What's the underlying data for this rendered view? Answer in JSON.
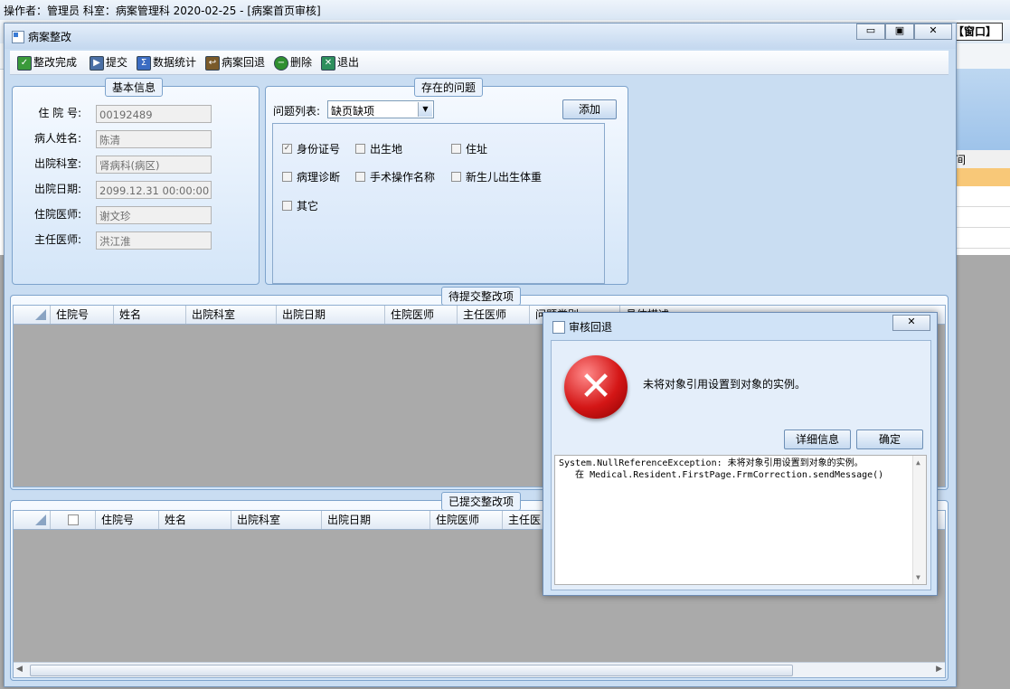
{
  "app": {
    "title_bar": "操作者：管理员  科室：病案管理科  2020-02-25 - [病案首页审核]",
    "window_menu": "【窗口】",
    "grid_col_fragment": "间"
  },
  "form": {
    "title": "病案整改",
    "toolbar": [
      {
        "label": "整改完成",
        "icon": "check-icon",
        "color": "#3a9a3a"
      },
      {
        "label": "提交",
        "icon": "submit-icon",
        "color": "#4a6fa5"
      },
      {
        "label": "数据统计",
        "icon": "sigma-icon",
        "color": "#3b6cc2"
      },
      {
        "label": "病案回退",
        "icon": "return-icon",
        "color": "#7a5a2a"
      },
      {
        "label": "删除",
        "icon": "delete-icon",
        "color": "#2f8f2f"
      },
      {
        "label": "退出",
        "icon": "exit-icon",
        "color": "#2d8f5d"
      }
    ],
    "basic_info": {
      "title": "基本信息",
      "fields": [
        {
          "label": "住 院 号:",
          "value": "00192489"
        },
        {
          "label": "病人姓名:",
          "value": "陈清"
        },
        {
          "label": "出院科室:",
          "value": "肾病科(病区)"
        },
        {
          "label": "出院日期:",
          "value": "2099.12.31 00:00:00"
        },
        {
          "label": "住院医师:",
          "value": "谢文珍"
        },
        {
          "label": "主任医师:",
          "value": "洪江淮"
        }
      ]
    },
    "problems": {
      "title": "存在的问题",
      "list_label": "问题列表:",
      "list_value": "缺页缺项",
      "add_button": "添加",
      "checkboxes": [
        {
          "label": "身份证号",
          "checked": true
        },
        {
          "label": "出生地",
          "checked": false
        },
        {
          "label": "住址",
          "checked": false
        },
        {
          "label": "病理诊断",
          "checked": false
        },
        {
          "label": "手术操作名称",
          "checked": false
        },
        {
          "label": "新生儿出生体重",
          "checked": false
        },
        {
          "label": "其它",
          "checked": false
        }
      ]
    },
    "pending": {
      "title": "待提交整改项",
      "columns": [
        "住院号",
        "姓名",
        "出院科室",
        "出院日期",
        "住院医师",
        "主任医师",
        "问题类别",
        "具体描述"
      ]
    },
    "submitted": {
      "title": "已提交整改项",
      "columns": [
        "住院号",
        "姓名",
        "出院科室",
        "出院日期",
        "住院医师",
        "主任医"
      ]
    }
  },
  "dialog": {
    "title": "审核回退",
    "message": "未将对象引用设置到对象的实例。",
    "details_button": "详细信息",
    "ok_button": "确定",
    "details": [
      "System.NullReferenceException: 未将对象引用设置到对象的实例。",
      "   在 Medical.Resident.FirstPage.FrmCorrection.sendMessage()"
    ]
  }
}
